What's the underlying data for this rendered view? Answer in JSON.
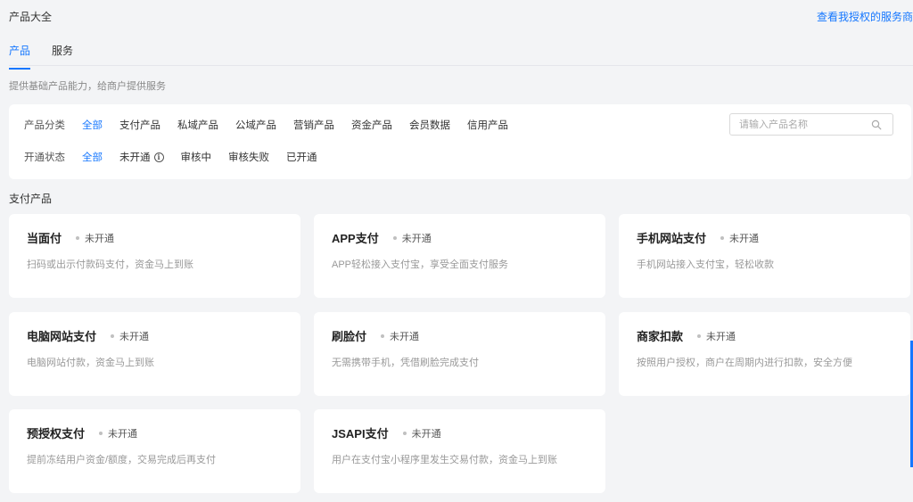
{
  "header": {
    "title": "产品大全",
    "link": "查看我授权的服务商"
  },
  "tabs": [
    {
      "label": "产品",
      "active": true
    },
    {
      "label": "服务",
      "active": false
    }
  ],
  "description": "提供基础产品能力，给商户提供服务",
  "filters": {
    "category": {
      "label": "产品分类",
      "options": [
        "全部",
        "支付产品",
        "私域产品",
        "公域产品",
        "营销产品",
        "资金产品",
        "会员数据",
        "信用产品"
      ],
      "active_index": 0
    },
    "status": {
      "label": "开通状态",
      "options": [
        "全部",
        "未开通",
        "审核中",
        "审核失败",
        "已开通"
      ],
      "active_index": 0
    },
    "search": {
      "placeholder": "请输入产品名称"
    }
  },
  "section": {
    "title": "支付产品",
    "products": [
      {
        "name": "当面付",
        "status": "未开通",
        "desc": "扫码或出示付款码支付，资金马上到账"
      },
      {
        "name": "APP支付",
        "status": "未开通",
        "desc": "APP轻松接入支付宝，享受全面支付服务"
      },
      {
        "name": "手机网站支付",
        "status": "未开通",
        "desc": "手机网站接入支付宝，轻松收款"
      },
      {
        "name": "电脑网站支付",
        "status": "未开通",
        "desc": "电脑网站付款，资金马上到账"
      },
      {
        "name": "刷脸付",
        "status": "未开通",
        "desc": "无需携带手机，凭借刷脸完成支付"
      },
      {
        "name": "商家扣款",
        "status": "未开通",
        "desc": "按照用户授权，商户在周期内进行扣款，安全方便"
      },
      {
        "name": "预授权支付",
        "status": "未开通",
        "desc": "提前冻结用户资金/额度，交易完成后再支付"
      },
      {
        "name": "JSAPI支付",
        "status": "未开通",
        "desc": "用户在支付宝小程序里发生交易付款，资金马上到账"
      }
    ]
  },
  "colors": {
    "accent": "#1677ff",
    "background": "#f3f4f6",
    "card": "#ffffff"
  },
  "icons": {
    "search": "search-icon",
    "info": "info-icon",
    "status": "status-dot-icon"
  }
}
